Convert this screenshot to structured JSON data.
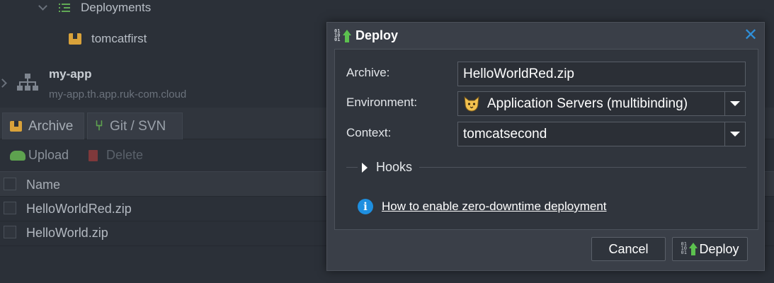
{
  "tree": {
    "deployments_label": "Deployments",
    "deployment_item": "tomcatfirst",
    "env_name": "my-app",
    "env_domain": "my-app.th.app.ruk-com.cloud"
  },
  "tabs": [
    {
      "label": "Archive",
      "active": true
    },
    {
      "label": "Git / SVN",
      "active": false
    }
  ],
  "toolbar": {
    "upload_label": "Upload",
    "delete_label": "Delete"
  },
  "grid": {
    "header_name": "Name",
    "rows": [
      "HelloWorldRed.zip",
      "HelloWorld.zip"
    ]
  },
  "dialog": {
    "title": "Deploy",
    "archive_label": "Archive:",
    "archive_value": "HelloWorldRed.zip",
    "environment_label": "Environment:",
    "environment_value": "Application Servers (multibinding)",
    "context_label": "Context:",
    "context_value": "tomcatsecond",
    "hooks_label": "Hooks",
    "info_link": "How to enable zero-downtime deployment",
    "cancel_label": "Cancel",
    "deploy_label": "Deploy"
  },
  "colors": {
    "accent_blue": "#2f8fd8",
    "deploy_green": "#5cc14f",
    "archive_orange": "#d9a23a"
  }
}
